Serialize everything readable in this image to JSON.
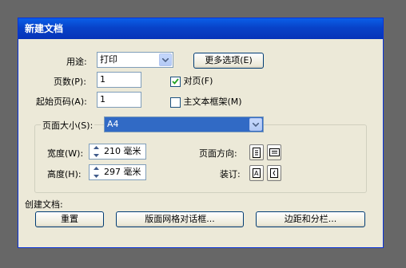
{
  "window": {
    "title": "新建文档"
  },
  "usage": {
    "label": "用途:",
    "value": "打印"
  },
  "more_options_button": "更多选项(E)",
  "pages": {
    "label": "页数(P):",
    "value": "1"
  },
  "facing_pages": {
    "label": "对页(F)",
    "checked": true
  },
  "start_page": {
    "label": "起始页码(A):",
    "value": "1"
  },
  "master_text_frame": {
    "label": "主文本框架(M)",
    "checked": false
  },
  "page_size": {
    "label": "页面大小(S):",
    "value": "A4"
  },
  "width": {
    "label": "宽度(W):",
    "value": "210 毫米"
  },
  "height": {
    "label": "高度(H):",
    "value": "297 毫米"
  },
  "orientation": {
    "label": "页面方向:",
    "options": [
      "portrait-icon",
      "landscape-icon"
    ],
    "selected": "portrait-icon"
  },
  "binding": {
    "label": "装订:",
    "options": [
      "left-to-right-icon",
      "right-to-left-icon"
    ],
    "selected": "left-to-right-icon"
  },
  "create_document": {
    "label": "创建文档:"
  },
  "buttons": {
    "reset": "重置",
    "layout_grid": "版面网格对话框...",
    "margins_columns": "边距和分栏..."
  },
  "colors": {
    "title_bar": "#0842c8",
    "dialog_bg": "#ece9d8",
    "selection": "#316ac5"
  }
}
